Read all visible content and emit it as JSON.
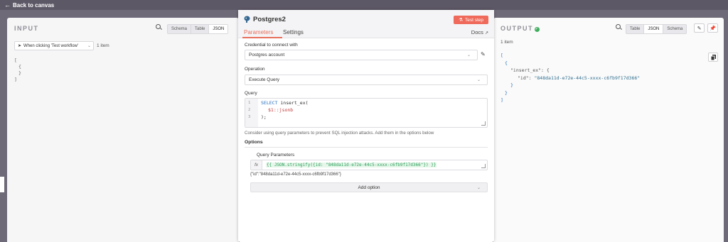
{
  "topbar": {
    "back_label": "Back to canvas",
    "ghost_text": "ow"
  },
  "input_panel": {
    "title": "INPUT",
    "view_tabs": [
      "Schema",
      "Table",
      "JSON"
    ],
    "active_tab": "JSON",
    "node_select": "When clicking 'Test workflow'",
    "items_count": "1 item",
    "json_lines": [
      "[",
      "  {",
      "  }",
      "]"
    ]
  },
  "node": {
    "title": "Postgres2",
    "test_button": "Test step",
    "tabs": [
      "Parameters",
      "Settings"
    ],
    "active_tab": "Parameters",
    "docs_label": "Docs",
    "credential_label": "Credential to connect with",
    "credential_value": "Postgres account",
    "operation_label": "Operation",
    "operation_value": "Execute Query",
    "query_label": "Query",
    "query_lines": [
      {
        "num": "1",
        "kw": "SELECT",
        "rest": " insert_ex("
      },
      {
        "num": "2",
        "ph": "$1",
        "rest": "::jsonb"
      },
      {
        "num": "3",
        "rest": ");"
      }
    ],
    "hint": "Consider using query parameters to prevent SQL injection attacks. Add them in the options below",
    "options_label": "Options",
    "query_params_label": "Query Parameters",
    "fx_label": "fx",
    "expression": "{{ JSON.stringify({id: \"848da11d-e72e-44c5-xxxx-c6fb9f17d366\"}) }}",
    "expression_preview": "{\"id\":\"848da11d-e72e-44c5-xxxx-c6fb9f17d366\"}",
    "add_option": "Add option"
  },
  "output_panel": {
    "title": "OUTPUT",
    "view_tabs": [
      "Table",
      "JSON",
      "Schema"
    ],
    "active_tab": "JSON",
    "items_count": "1 item",
    "json": {
      "open_bracket": "[",
      "open_brace": "{",
      "key1": "\"insert_ex\"",
      "colon1": ": {",
      "key2": "\"id\"",
      "colon2": ": ",
      "value2": "\"848da11d-e72e-44c5-xxxx-c6fb9f17d366\"",
      "close_inner": "}",
      "close_brace": "}",
      "close_bracket": "]"
    }
  },
  "colors": {
    "accent": "#ef6a5a",
    "success": "#3fae5e",
    "background": "#6f6a78"
  }
}
